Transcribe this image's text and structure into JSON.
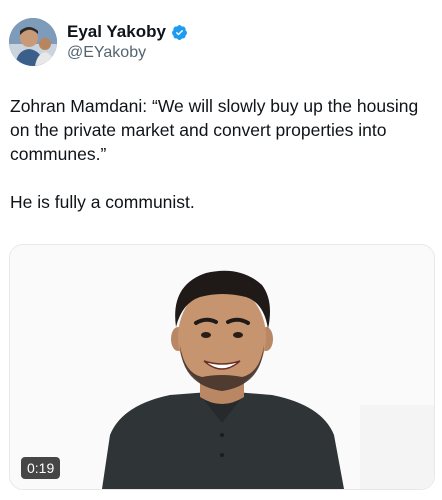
{
  "author": {
    "display_name": "Eyal Yakoby",
    "handle": "@EYakoby",
    "verified": true,
    "avatar_icon": "profile-photo"
  },
  "tweet": {
    "paragraphs": [
      "Zohran Mamdani: “We will slowly buy up the housing on the private market and convert properties into communes.”",
      "He is fully a communist."
    ]
  },
  "media": {
    "type": "video",
    "duration": "0:19"
  },
  "colors": {
    "verified_badge": "#1d9bf0",
    "text_primary": "#0f1419",
    "text_secondary": "#536471"
  }
}
